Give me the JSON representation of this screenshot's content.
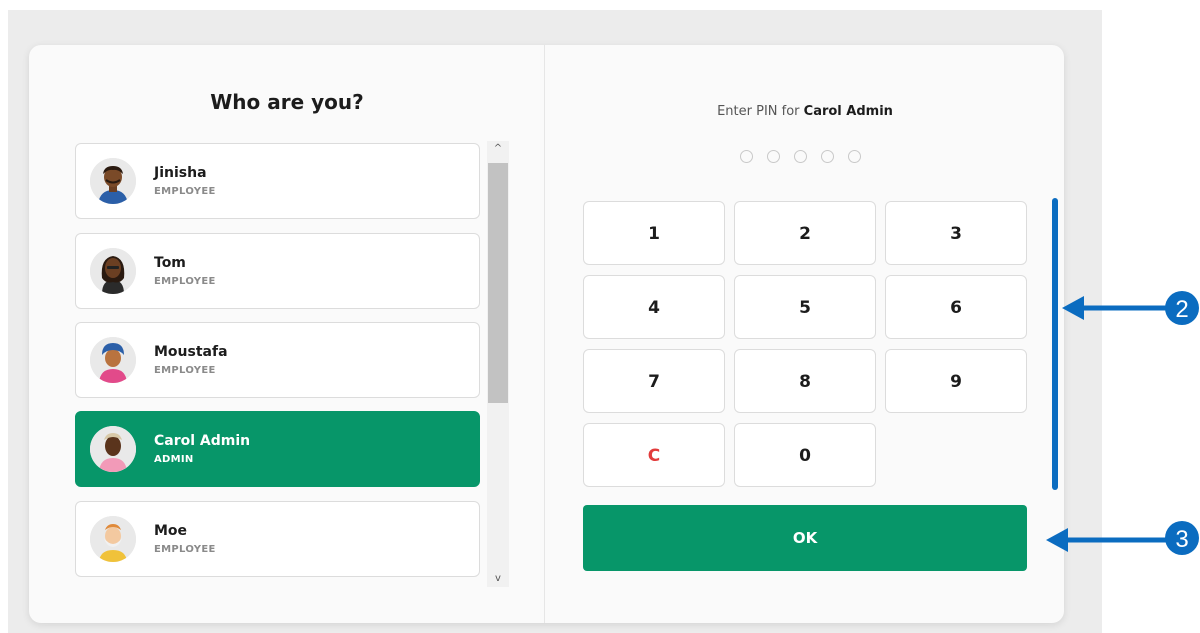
{
  "title": "Who are you?",
  "users": [
    {
      "name": "Jinisha",
      "role": "EMPLOYEE"
    },
    {
      "name": "Tom",
      "role": "EMPLOYEE"
    },
    {
      "name": "Moustafa",
      "role": "EMPLOYEE"
    },
    {
      "name": "Carol Admin",
      "role": "ADMIN"
    },
    {
      "name": "Moe",
      "role": "EMPLOYEE"
    }
  ],
  "selected_user": "Carol Admin",
  "pin": {
    "prompt_prefix": "Enter PIN for",
    "prompt_name": "Carol Admin",
    "length": 5,
    "entered": 0
  },
  "keypad": {
    "k1": "1",
    "k2": "2",
    "k3": "3",
    "k4": "4",
    "k5": "5",
    "k6": "6",
    "k7": "7",
    "k8": "8",
    "k9": "9",
    "clear": "C",
    "k0": "0"
  },
  "ok_label": "OK",
  "scroll": {
    "up_icon": "^",
    "down_icon": "v"
  },
  "annotations": {
    "a2": "2",
    "a3": "3"
  },
  "colors": {
    "accent": "#079669",
    "clear": "#e23b3b",
    "annotation": "#0b6cc0"
  }
}
